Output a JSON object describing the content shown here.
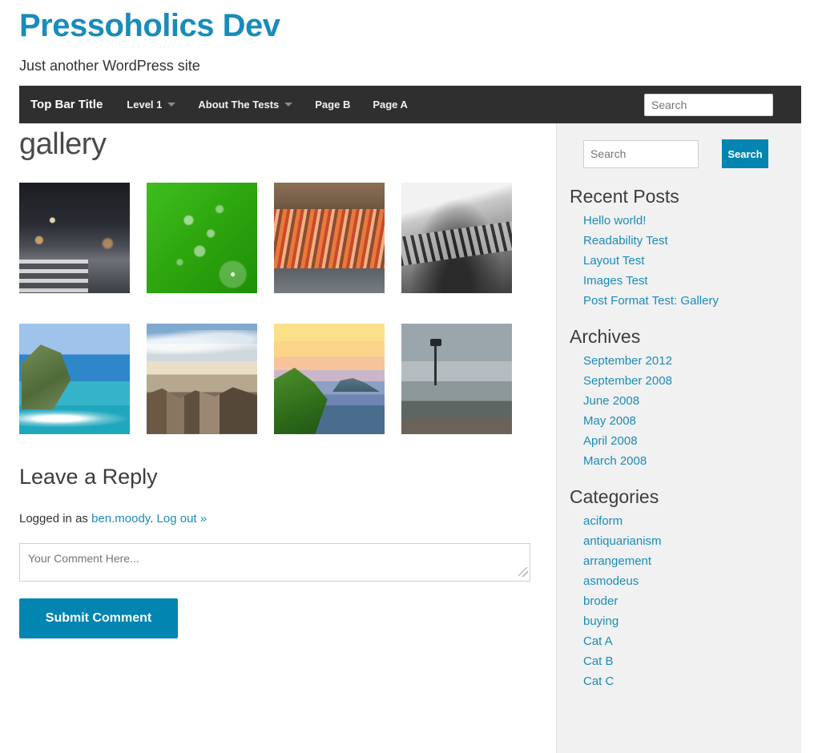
{
  "site": {
    "title": "Pressoholics Dev",
    "description": "Just another WordPress site"
  },
  "navbar": {
    "brand": "Top Bar Title",
    "items": [
      {
        "label": "Level 1",
        "has_dropdown": true
      },
      {
        "label": "About The Tests",
        "has_dropdown": true
      },
      {
        "label": "Page B",
        "has_dropdown": false
      },
      {
        "label": "Page A",
        "has_dropdown": false
      }
    ],
    "search_placeholder": "Search",
    "search_value": ""
  },
  "main": {
    "title": "gallery",
    "gallery": {
      "rows": [
        [
          {
            "alt": "city-street-at-night",
            "art": "t-city"
          },
          {
            "alt": "green-leaf-with-water-droplets",
            "art": "t-leaf"
          },
          {
            "alt": "orange-rock-strata",
            "art": "t-strata"
          },
          {
            "alt": "black-and-white-rock",
            "art": "t-bwrock"
          }
        ],
        [
          {
            "alt": "coastal-cliff-turquoise-water",
            "art": "t-cliff"
          },
          {
            "alt": "rocky-beach-with-clouds",
            "art": "t-beach"
          },
          {
            "alt": "sunset-over-coastal-hills",
            "art": "t-sunset"
          },
          {
            "alt": "foggy-landscape-with-pole",
            "art": "t-fog"
          }
        ]
      ]
    },
    "comments": {
      "heading": "Leave a Reply",
      "logged_in_prefix": "Logged in as ",
      "username": "ben.moody",
      "separator": ". ",
      "logout_label": "Log out »",
      "comment_placeholder": "Your Comment Here...",
      "comment_value": "",
      "submit_label": "Submit Comment"
    }
  },
  "sidebar": {
    "search": {
      "placeholder": "Search",
      "value": "",
      "button_label": "Search"
    },
    "widgets": [
      {
        "title": "Recent Posts",
        "links": [
          "Hello world!",
          "Readability Test",
          "Layout Test",
          "Images Test",
          "Post Format Test: Gallery"
        ]
      },
      {
        "title": "Archives",
        "links": [
          "September 2012",
          "September 2008",
          "June 2008",
          "May 2008",
          "April 2008",
          "March 2008"
        ]
      },
      {
        "title": "Categories",
        "links": [
          "aciform",
          "antiquarianism",
          "arrangement",
          "asmodeus",
          "broder",
          "buying",
          "Cat A",
          "Cat B",
          "Cat C"
        ]
      }
    ]
  },
  "colors": {
    "brand_blue": "#1a8cba",
    "button_blue": "#0285b0",
    "navbar_dark": "#2f2f2f",
    "sidebar_bg": "#f1f1f1",
    "link_blue": "#1a8cba"
  }
}
